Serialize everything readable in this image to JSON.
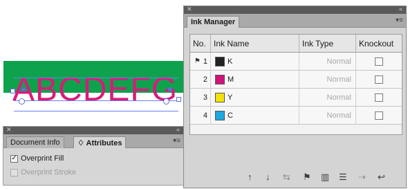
{
  "artboard": {
    "sample_text": "ABCDEFG",
    "band_color": "#0ea24c",
    "text_color": "#d81b7c"
  },
  "attributes_panel": {
    "tabs": [
      "Document Info",
      "♢ Attributes"
    ],
    "active_tab": "♢ Attributes",
    "overprint_fill": {
      "label": "Overprint Fill",
      "checked": true,
      "enabled": true
    },
    "overprint_stroke": {
      "label": "Overprint Stroke",
      "checked": false,
      "enabled": false
    },
    "collapse_icon": "double-arrow-icon",
    "menu_icon": "panel-menu-icon"
  },
  "ink_manager": {
    "tab_label": "Ink Manager",
    "columns": [
      "No.",
      "Ink Name",
      "Ink Type",
      "Knockout"
    ],
    "inks": [
      {
        "no": "1",
        "name": "K",
        "type": "Normal",
        "color": "#222222",
        "knockout": false,
        "process_marker": true
      },
      {
        "no": "2",
        "name": "M",
        "type": "Normal",
        "color": "#d0147a",
        "knockout": false,
        "process_marker": false
      },
      {
        "no": "3",
        "name": "Y",
        "type": "Normal",
        "color": "#f4e300",
        "knockout": false,
        "process_marker": false
      },
      {
        "no": "4",
        "name": "C",
        "type": "Normal",
        "color": "#1ea7e0",
        "knockout": false,
        "process_marker": false
      }
    ],
    "footer_icons": [
      "arrow-up-icon",
      "arrow-down-icon",
      "swap-icon",
      "flag-icon",
      "bars-icon",
      "alignment-icon",
      "spot-to-process-icon",
      "reset-icon"
    ]
  }
}
